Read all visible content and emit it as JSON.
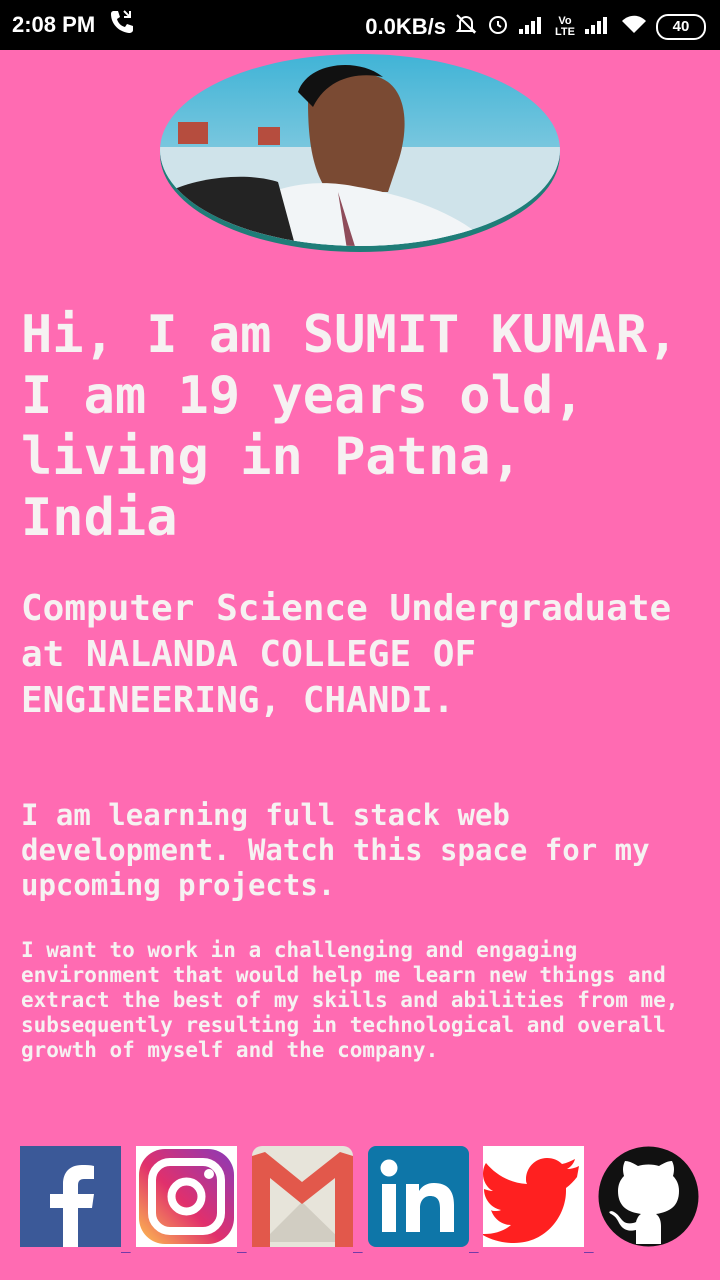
{
  "status": {
    "time": "2:08 PM",
    "speed": "0.0KB/s",
    "lte": "Vo LTE",
    "battery": "40"
  },
  "profile": {
    "avatar_alt": "profile photo",
    "headline": "Hi, I am SUMIT KUMAR, I am 19 years old, living in Patna, India",
    "education": "Computer Science Undergraduate at NALANDA COLLEGE OF ENGINEERING, CHANDI.",
    "learning": "I am learning full stack web development. Watch this space for my upcoming projects.",
    "objective": "I want to work in a challenging and engaging environment that would help me learn new things and extract the best of my skills and abilities from me, subsequently resulting in technological and overall growth of myself and the company."
  },
  "social": [
    {
      "name": "Facebook",
      "icon": "facebook-icon",
      "color": "#3b5998"
    },
    {
      "name": "Instagram",
      "icon": "instagram-icon",
      "color": "#c13584"
    },
    {
      "name": "Gmail",
      "icon": "gmail-icon",
      "color": "#ea4335"
    },
    {
      "name": "LinkedIn",
      "icon": "linkedin-icon",
      "color": "#0e76a8"
    },
    {
      "name": "Twitter",
      "icon": "twitter-icon",
      "color": "#ff2020"
    },
    {
      "name": "GitHub",
      "icon": "github-icon",
      "color": "#111111"
    }
  ],
  "colors": {
    "background": "#ff6bb2",
    "text": "#f6f2f2",
    "statusbar": "#000000"
  }
}
